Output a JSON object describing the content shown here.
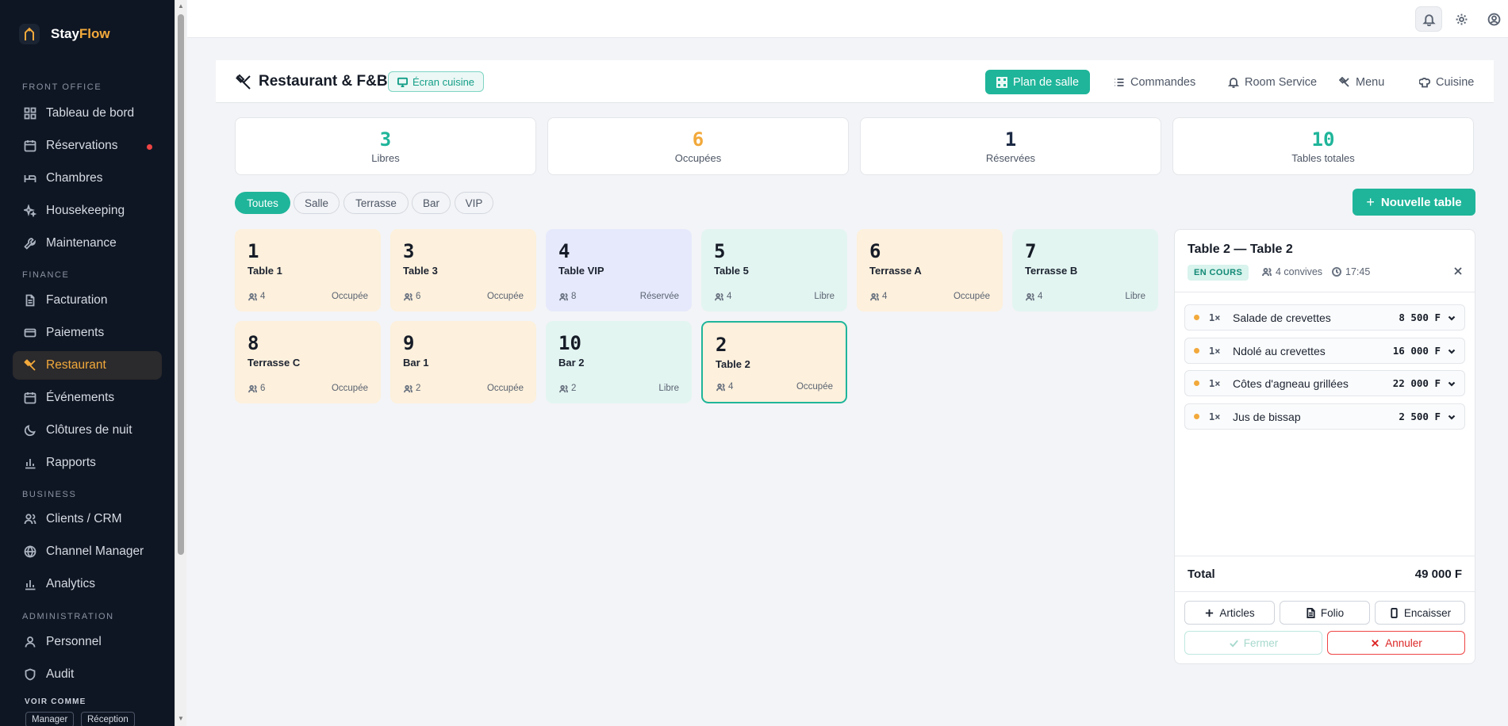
{
  "brand": {
    "part1": "Stay",
    "part2": "Flow"
  },
  "sidebar": {
    "sections": [
      {
        "label": "FRONT OFFICE"
      },
      {
        "label": "FINANCE"
      },
      {
        "label": "BUSINESS"
      },
      {
        "label": "ADMINISTRATION"
      }
    ],
    "items": [
      {
        "label": "Tableau de bord",
        "icon": "grid-icon"
      },
      {
        "label": "Réservations",
        "icon": "calendar-icon",
        "has_dot": true
      },
      {
        "label": "Chambres",
        "icon": "bed-icon"
      },
      {
        "label": "Housekeeping",
        "icon": "sparkles-icon"
      },
      {
        "label": "Maintenance",
        "icon": "wrench-icon"
      },
      {
        "label": "Facturation",
        "icon": "file-text-icon"
      },
      {
        "label": "Paiements",
        "icon": "credit-card-icon"
      },
      {
        "label": "Restaurant",
        "icon": "utensils-icon",
        "active": true
      },
      {
        "label": "Événements",
        "icon": "calendar-icon"
      },
      {
        "label": "Clôtures de nuit",
        "icon": "moon-icon"
      },
      {
        "label": "Rapports",
        "icon": "bar-chart-icon"
      },
      {
        "label": "Clients / CRM",
        "icon": "users-icon"
      },
      {
        "label": "Channel Manager",
        "icon": "globe-icon"
      },
      {
        "label": "Analytics",
        "icon": "bar-chart-icon"
      },
      {
        "label": "Personnel",
        "icon": "user-icon"
      },
      {
        "label": "Audit",
        "icon": "shield-icon"
      }
    ],
    "voir_comme": "VOIR COMME",
    "roles": [
      "Manager",
      "Réception"
    ]
  },
  "header": {
    "title": "Restaurant & F&B",
    "kitchen_button": "Écran cuisine",
    "tabs": [
      {
        "label": "Plan de salle",
        "icon": "layout-grid-icon",
        "active": true
      },
      {
        "label": "Commandes",
        "icon": "list-icon"
      },
      {
        "label": "Room Service",
        "icon": "bell-icon"
      },
      {
        "label": "Menu",
        "icon": "utensils-icon"
      },
      {
        "label": "Cuisine",
        "icon": "chef-hat-icon"
      }
    ]
  },
  "stats": [
    {
      "value": "3",
      "label": "Libres",
      "color": "#1fb59a"
    },
    {
      "value": "6",
      "label": "Occupées",
      "color": "#f2a93b"
    },
    {
      "value": "1",
      "label": "Réservées",
      "color": "#1c2a44"
    },
    {
      "value": "10",
      "label": "Tables totales",
      "color": "#1fb59a"
    }
  ],
  "filters": [
    "Toutes",
    "Salle",
    "Terrasse",
    "Bar",
    "VIP"
  ],
  "new_table_button": "Nouvelle table",
  "tables": [
    {
      "number": "1",
      "name": "Table 1",
      "seats": "4",
      "status": "Occupée"
    },
    {
      "number": "3",
      "name": "Table 3",
      "seats": "6",
      "status": "Occupée"
    },
    {
      "number": "4",
      "name": "Table VIP",
      "seats": "8",
      "status": "Réservée"
    },
    {
      "number": "5",
      "name": "Table 5",
      "seats": "4",
      "status": "Libre"
    },
    {
      "number": "6",
      "name": "Terrasse A",
      "seats": "4",
      "status": "Occupée"
    },
    {
      "number": "7",
      "name": "Terrasse B",
      "seats": "4",
      "status": "Libre"
    },
    {
      "number": "8",
      "name": "Terrasse C",
      "seats": "6",
      "status": "Occupée"
    },
    {
      "number": "9",
      "name": "Bar 1",
      "seats": "2",
      "status": "Occupée"
    },
    {
      "number": "10",
      "name": "Bar 2",
      "seats": "2",
      "status": "Libre"
    },
    {
      "number": "2",
      "name": "Table 2",
      "seats": "4",
      "status": "Occupée",
      "selected": true
    }
  ],
  "panel": {
    "title": "Table 2 — Table 2",
    "badge": "EN COURS",
    "guests": "4 convives",
    "time": "17:45",
    "items": [
      {
        "qty": "1×",
        "name": "Salade de crevettes",
        "price": "8 500 F"
      },
      {
        "qty": "1×",
        "name": "Ndolé au crevettes",
        "price": "16 000 F"
      },
      {
        "qty": "1×",
        "name": "Côtes d'agneau grillées",
        "price": "22 000 F"
      },
      {
        "qty": "1×",
        "name": "Jus de bissap",
        "price": "2 500 F"
      }
    ],
    "total_label": "Total",
    "total_value": "49 000 F",
    "buttons": {
      "articles": "Articles",
      "folio": "Folio",
      "encaisser": "Encaisser",
      "fermer": "Fermer",
      "annuler": "Annuler"
    }
  }
}
